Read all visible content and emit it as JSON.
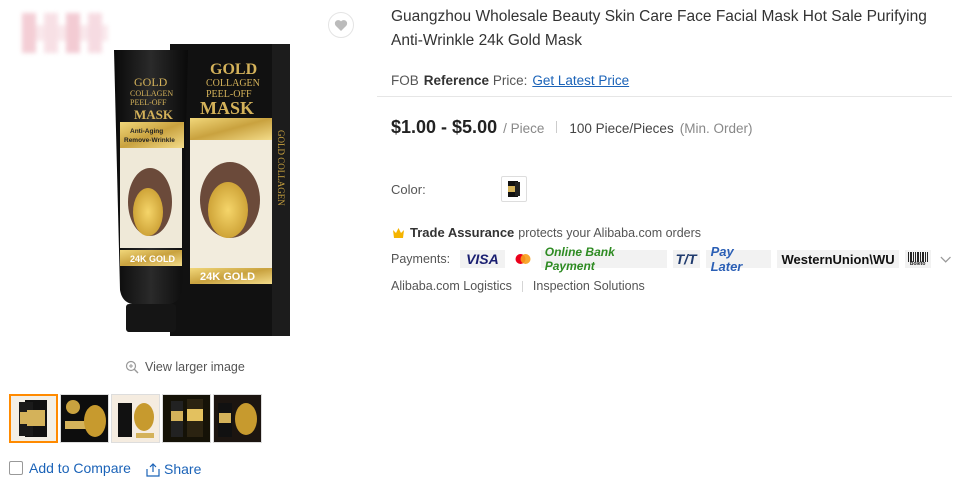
{
  "gallery": {
    "view_larger_label": "View larger image",
    "thumbnails": [
      "thumb-1",
      "thumb-2",
      "thumb-3",
      "thumb-4",
      "thumb-5"
    ],
    "active_thumbnail": 0,
    "product_image": {
      "tube_text": [
        "GOLD",
        "COLLAGEN",
        "PEEL-OFF",
        "MASK"
      ],
      "tube_sub": [
        "Anti-Aging",
        "Remove-Wrinkle"
      ],
      "gold_label": "24K GOLD",
      "box_side_text": "GOLD COLLAGEN"
    }
  },
  "actions": {
    "compare_label": "Add to Compare",
    "share_label": "Share"
  },
  "product": {
    "title": "Guangzhou Wholesale Beauty Skin Care Face Facial Mask Hot Sale Purifying Anti-Wrinkle 24k Gold Mask",
    "fob_prefix": "FOB",
    "fob_bold": "Reference",
    "fob_suffix": "Price:",
    "fob_link": "Get Latest Price",
    "price_range": "$1.00 - $5.00",
    "price_unit": "/ Piece",
    "moq": "100 Piece/Pieces",
    "moq_suffix": "(Min. Order)",
    "color_label": "Color:",
    "trade_assurance_label": "Trade Assurance",
    "trade_assurance_text": "protects your Alibaba.com orders",
    "payments_label": "Payments:",
    "payment_methods": {
      "visa": "VISA",
      "online_bank": "Online Bank Payment",
      "tt": "T/T",
      "pay_later": "Pay Later",
      "western_union": "WesternUnion\\WU",
      "boleto": "Boleto"
    },
    "services": [
      "Alibaba.com Logistics",
      "Inspection Solutions"
    ]
  },
  "colors": {
    "link": "#1b63b8",
    "active_thumb_border": "#ff8a00",
    "gold": "#c9a23f"
  }
}
